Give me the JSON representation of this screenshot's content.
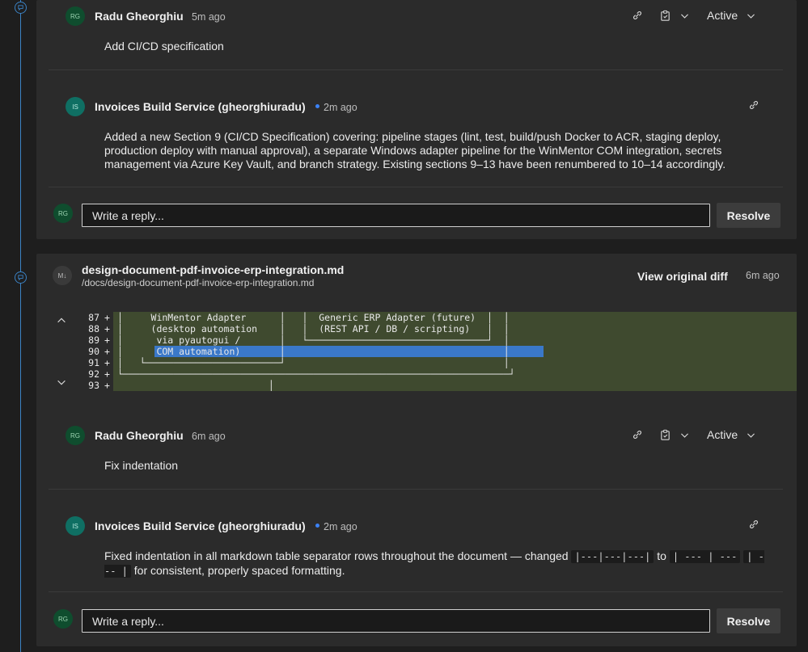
{
  "thread1": {
    "comment1": {
      "avatar": "RG",
      "author": "Radu Gheorghiu",
      "time": "5m ago",
      "status": "Active",
      "body": "Add CI/CD specification"
    },
    "comment2": {
      "avatar": "IS",
      "author": "Invoices Build Service (gheorghiuradu)",
      "time": "2m ago",
      "body": "Added a new Section 9 (CI/CD Specification) covering: pipeline stages (lint, test, build/push Docker to ACR, staging deploy, production deploy with manual approval), a separate Windows adapter pipeline for the WinMentor COM integration, secrets management via Azure Key Vault, and branch strategy. Existing sections 9–13 have been renumbered to 10–14 accordingly."
    },
    "reply": {
      "avatar": "RG",
      "placeholder": "Write a reply...",
      "resolve_label": "Resolve"
    }
  },
  "thread2": {
    "file": {
      "avatar": "M↓",
      "name": "design-document-pdf-invoice-erp-integration.md",
      "path": "/docs/design-document-pdf-invoice-erp-integration.md",
      "view_diff_label": "View original diff",
      "time": "6m ago"
    },
    "diff_lines": [
      {
        "num": "87",
        "sign": "+",
        "code": "│     WinMentor Adapter      │   │  Generic ERP Adapter (future)  │  │"
      },
      {
        "num": "88",
        "sign": "+",
        "code": "│     (desktop automation    │   │  (REST API / DB / scripting)   │  │"
      },
      {
        "num": "89",
        "sign": "+",
        "code": "│      via pyautogui /       │   └────────────────────────────────┘  │"
      },
      {
        "num": "90",
        "sign": "+",
        "code": "│      COM automation)       │                                       │"
      },
      {
        "num": "91",
        "sign": "+",
        "code": "│   └────────────────────────┘                                       │"
      },
      {
        "num": "92",
        "sign": "+",
        "code": "└─────────────────────────────────────────────────────────────────────┘"
      },
      {
        "num": "93",
        "sign": "+",
        "code": "                           │"
      }
    ],
    "comment1": {
      "avatar": "RG",
      "author": "Radu Gheorghiu",
      "time": "6m ago",
      "status": "Active",
      "body": "Fix indentation"
    },
    "comment2": {
      "avatar": "IS",
      "author": "Invoices Build Service (gheorghiuradu)",
      "time": "2m ago",
      "body_pre": "Fixed indentation in all markdown table separator rows throughout the document — changed",
      "code1": "|---|---|---|",
      "body_mid": "to",
      "code2": "| --- | ---",
      "code3": "| --- |",
      "body_post": "for consistent, properly spaced formatting."
    },
    "reply": {
      "avatar": "RG",
      "placeholder": "Write a reply...",
      "resolve_label": "Resolve"
    }
  },
  "colors": {
    "accent": "#3b82c4",
    "diff_added_bg": "#3f4a2f",
    "selection": "#3a78c9"
  },
  "icons": [
    "comment-icon",
    "link-icon",
    "clipboard-check-icon",
    "chevron-down-icon",
    "chevron-up-icon"
  ]
}
